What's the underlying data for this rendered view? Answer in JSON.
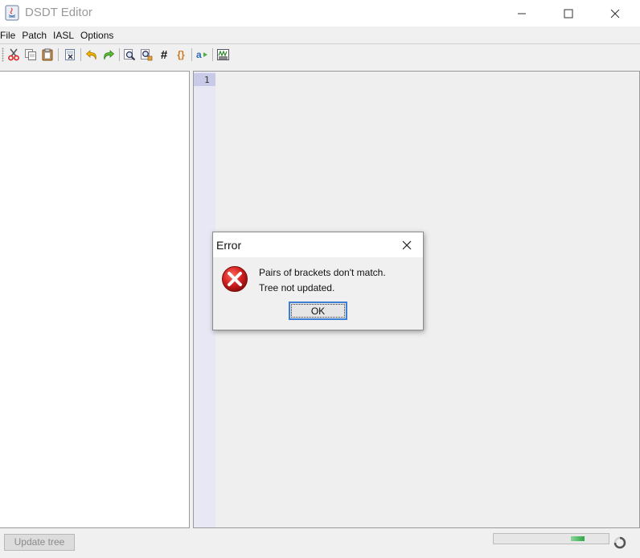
{
  "window": {
    "title": "DSDT Editor"
  },
  "menu": {
    "items": [
      {
        "label": "File"
      },
      {
        "label": "Patch"
      },
      {
        "label": "IASL"
      },
      {
        "label": "Options"
      }
    ]
  },
  "toolbar": {
    "hash_label": "#",
    "brace_label": "{}",
    "compile_label": "a"
  },
  "editor": {
    "line_numbers": [
      "1"
    ]
  },
  "bottom": {
    "update_tree_label": "Update tree",
    "progress_fraction": 0.12
  },
  "dialog": {
    "title": "Error",
    "message_line1": "Pairs of brackets don't match.",
    "message_line2": "Tree not updated.",
    "ok_label": "OK"
  },
  "colors": {
    "accent_focus": "#3c7fd4",
    "error_red": "#d21f1f",
    "progress_green": "#2fa646",
    "gutter": "#e8e8f5"
  },
  "icons": {
    "toolbar": [
      "cut-icon",
      "copy-icon",
      "paste-icon",
      "delete-icon",
      "undo-icon",
      "redo-icon",
      "find-icon",
      "find-replace-icon",
      "goto-line-icon",
      "match-brace-icon",
      "compile-icon",
      "export-icon"
    ],
    "dialog": "error-icon"
  }
}
